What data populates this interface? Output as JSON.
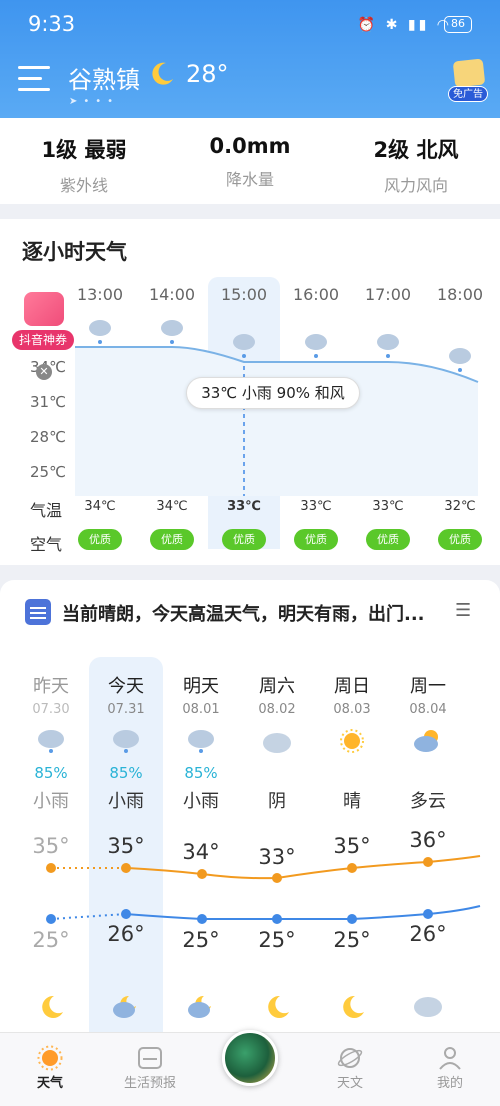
{
  "status_bar": {
    "time": "9:33",
    "battery": "86"
  },
  "header": {
    "city": "谷熟镇",
    "temp": "28°",
    "badge": "免广告"
  },
  "stats": [
    {
      "value": "1级 最弱",
      "label": "紫外线"
    },
    {
      "value": "0.0mm",
      "label": "降水量"
    },
    {
      "value": "2级 北风",
      "label": "风力风向"
    }
  ],
  "hourly": {
    "title": "逐小时天气",
    "hours": [
      "13:00",
      "14:00",
      "15:00",
      "16:00",
      "17:00",
      "18:00"
    ],
    "temps": [
      "34℃",
      "34℃",
      "33℃",
      "33℃",
      "33℃",
      "32℃"
    ],
    "air": [
      "优质",
      "优质",
      "优质",
      "优质",
      "优质",
      "优质"
    ],
    "y_labels": [
      "34℃",
      "31℃",
      "28℃",
      "25℃"
    ],
    "row_temp_label": "气温",
    "row_air_label": "空气",
    "tooltip": "33℃ 小雨 90% 和风",
    "promo_label": "抖音神券"
  },
  "summary": "当前晴朗，今天高温天气，明天有雨，出门...",
  "daily": {
    "days": [
      {
        "name": "昨天",
        "date": "07.30",
        "precip": "85%",
        "weather": "小雨",
        "high": "35°",
        "low": "25°"
      },
      {
        "name": "今天",
        "date": "07.31",
        "precip": "85%",
        "weather": "小雨",
        "high": "35°",
        "low": "26°"
      },
      {
        "name": "明天",
        "date": "08.01",
        "precip": "85%",
        "weather": "小雨",
        "high": "34°",
        "low": "25°"
      },
      {
        "name": "周六",
        "date": "08.02",
        "precip": "",
        "weather": "阴",
        "high": "33°",
        "low": "25°"
      },
      {
        "name": "周日",
        "date": "08.03",
        "precip": "",
        "weather": "晴",
        "high": "35°",
        "low": "25°"
      },
      {
        "name": "周一",
        "date": "08.04",
        "precip": "",
        "weather": "多云",
        "high": "36°",
        "low": "26°"
      }
    ]
  },
  "nav": {
    "weather": "天气",
    "life": "生活预报",
    "astro": "天文",
    "me": "我的"
  },
  "colors": {
    "header": "#3f95ef",
    "high_line": "#f29a1f",
    "low_line": "#3f88e6",
    "air_badge": "#5ac82a"
  }
}
